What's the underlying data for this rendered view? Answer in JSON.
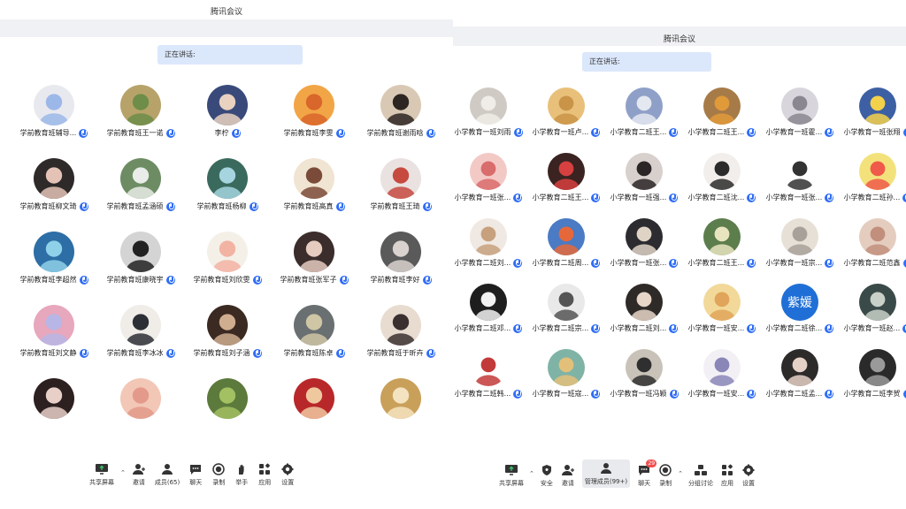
{
  "left": {
    "title": "腾讯会议",
    "speaking_label": "正在讲话:",
    "participants": [
      {
        "name": "学前教育班辅导...",
        "color": "#e8e8ef",
        "accent": "#9bb8e8"
      },
      {
        "name": "学前教育班王一诺",
        "color": "#b7a36a",
        "accent": "#6d8d48"
      },
      {
        "name": "李柠",
        "color": "#394a7a",
        "accent": "#e9d2c0"
      },
      {
        "name": "学前教育班李雯",
        "color": "#f2a546",
        "accent": "#d9662b"
      },
      {
        "name": "学前教育班谢雨晗",
        "color": "#d9c9b4",
        "accent": "#2c2522"
      },
      {
        "name": "学前教育班柳文琦",
        "color": "#2e2a2a",
        "accent": "#e4c3b6"
      },
      {
        "name": "学前教育班孟涵硕",
        "color": "#6d8c63",
        "accent": "#e9ece8"
      },
      {
        "name": "学前教育班杨柳",
        "color": "#3a6a5d",
        "accent": "#a6d5df"
      },
      {
        "name": "学前教育班高真",
        "color": "#f0e4d2",
        "accent": "#7b4b3a"
      },
      {
        "name": "学前教育班王琦",
        "color": "#e9e2e0",
        "accent": "#c64a3f"
      },
      {
        "name": "学前教育班李超然",
        "color": "#2c6ea5",
        "accent": "#8fd1e8"
      },
      {
        "name": "学前教育班康晓宇",
        "color": "#d4d4d4",
        "accent": "#222222"
      },
      {
        "name": "学前教育班刘欣雯",
        "color": "#f4f0e8",
        "accent": "#f2b3a3"
      },
      {
        "name": "学前教育班张军子",
        "color": "#3a2d2c",
        "accent": "#e6cbbf"
      },
      {
        "name": "学前教育班李好",
        "color": "#5a5a5a",
        "accent": "#d9d2cf"
      },
      {
        "name": "学前教育班刘文静",
        "color": "#e7a7bd",
        "accent": "#b7b6e6"
      },
      {
        "name": "学前教育班李冰冰",
        "color": "#f0ece8",
        "accent": "#2c2f36"
      },
      {
        "name": "学前教育班刘子涵",
        "color": "#3b2a22",
        "accent": "#cfae8f"
      },
      {
        "name": "学前教育班陈卓",
        "color": "#6a6f72",
        "accent": "#cfc6a5"
      },
      {
        "name": "学前教育班于昕卉",
        "color": "#e8dcd0",
        "accent": "#3a3030"
      },
      {
        "name": "",
        "color": "#2d2020",
        "accent": "#e8d0c8"
      },
      {
        "name": "",
        "color": "#f2c7b6",
        "accent": "#e39a8a"
      },
      {
        "name": "",
        "color": "#5b7a3b",
        "accent": "#a3c063"
      },
      {
        "name": "",
        "color": "#b8282a",
        "accent": "#f0c8a0"
      },
      {
        "name": "",
        "color": "#c9a05a",
        "accent": "#f4e3c0"
      }
    ],
    "toolbar": [
      {
        "label": "共享屏幕",
        "icon": "share-screen-icon",
        "caret": true
      },
      {
        "label": "邀请",
        "icon": "invite-icon"
      },
      {
        "label": "成员(65)",
        "icon": "members-icon"
      },
      {
        "label": "聊天",
        "icon": "chat-icon"
      },
      {
        "label": "录制",
        "icon": "record-icon"
      },
      {
        "label": "举手",
        "icon": "raise-hand-icon"
      },
      {
        "label": "应用",
        "icon": "apps-icon"
      },
      {
        "label": "设置",
        "icon": "settings-icon"
      }
    ]
  },
  "right": {
    "title": "腾讯会议",
    "speaking_label": "正在讲话:",
    "participants": [
      {
        "name": "小学教育一班刘雨",
        "color": "#cfcac4",
        "accent": "#f0ede8"
      },
      {
        "name": "小学教育一班卢...",
        "color": "#e9c07a",
        "accent": "#c99448"
      },
      {
        "name": "小学教育二班王...",
        "color": "#8fa0c8",
        "accent": "#e4e8f0"
      },
      {
        "name": "小学教育二班王...",
        "color": "#a77b48",
        "accent": "#e09a3a"
      },
      {
        "name": "小学教育一班霍...",
        "color": "#d8d6dc",
        "accent": "#8b8790"
      },
      {
        "name": "小学教育一班张翔",
        "color": "#3d5fa3",
        "accent": "#f4d14a"
      },
      {
        "name": "小学教育一班张...",
        "color": "#f3c9c6",
        "accent": "#d96c6c"
      },
      {
        "name": "小学教育二班王...",
        "color": "#3a2320",
        "accent": "#d64040"
      },
      {
        "name": "小学教育一班强...",
        "color": "#d8d0cc",
        "accent": "#2c2525"
      },
      {
        "name": "小学教育二班沈...",
        "color": "#f2eeec",
        "accent": "#2b2b2b"
      },
      {
        "name": "小学教育一班张...",
        "color": "#ffffff",
        "accent": "#333333"
      },
      {
        "name": "小学教育二班孙...",
        "color": "#f3e27c",
        "accent": "#f05a4a"
      },
      {
        "name": "小学教育二班刘...",
        "color": "#f0e8e2",
        "accent": "#c7a07e"
      },
      {
        "name": "小学教育二班周...",
        "color": "#4a7bc4",
        "accent": "#e6683a"
      },
      {
        "name": "小学教育一班张...",
        "color": "#2b2b30",
        "accent": "#dfd3c6"
      },
      {
        "name": "小学教育二班王...",
        "color": "#5c7d4c",
        "accent": "#e8e4c0"
      },
      {
        "name": "小学教育一班宗...",
        "color": "#e6e0d6",
        "accent": "#a8a19a"
      },
      {
        "name": "小学教育二班范鑫",
        "color": "#e4cdbf",
        "accent": "#c28f7c"
      },
      {
        "name": "小学教育二班邓...",
        "color": "#1e1e1e",
        "accent": "#f2f2f2"
      },
      {
        "name": "小学教育二班宗...",
        "color": "#e9e9e9",
        "accent": "#555555"
      },
      {
        "name": "小学教育二班刘...",
        "color": "#2e2a28",
        "accent": "#e8d6c8"
      },
      {
        "name": "小学教育一班安...",
        "color": "#f2d99a",
        "accent": "#e0a55a"
      },
      {
        "name": "小学教育二班徐...",
        "color": "#1f6fd6",
        "accent": "#1f6fd6",
        "text": "紫媛"
      },
      {
        "name": "小学教育一班赵...",
        "color": "#3a4a48",
        "accent": "#c8d0c8"
      },
      {
        "name": "小学教育二班韩...",
        "color": "#ffffff",
        "accent": "#c23a3a"
      },
      {
        "name": "小学教育一班寇...",
        "color": "#7fb3a6",
        "accent": "#e3c07a"
      },
      {
        "name": "小学教育一班冯颖",
        "color": "#c9c2b8",
        "accent": "#2f2f2f"
      },
      {
        "name": "小学教育一班安...",
        "color": "#f3f0f5",
        "accent": "#8a86b8"
      },
      {
        "name": "小学教育二班孟...",
        "color": "#2d2a2a",
        "accent": "#e6d1c6"
      },
      {
        "name": "小学教育二班李贺",
        "color": "#2a2a2a",
        "accent": "#9a9a9a"
      }
    ],
    "toolbar": [
      {
        "label": "共享屏幕",
        "icon": "share-screen-icon",
        "caret": true
      },
      {
        "label": "安全",
        "icon": "security-icon"
      },
      {
        "label": "邀请",
        "icon": "invite-icon"
      },
      {
        "label": "管理成员(99+)",
        "icon": "manage-members-icon",
        "active": true
      },
      {
        "label": "聊天",
        "icon": "chat-icon",
        "badge": "29"
      },
      {
        "label": "录制",
        "icon": "record-icon",
        "caret": true
      },
      {
        "label": "分组讨论",
        "icon": "breakout-icon"
      },
      {
        "label": "应用",
        "icon": "apps-icon"
      },
      {
        "label": "设置",
        "icon": "settings-icon"
      }
    ]
  }
}
